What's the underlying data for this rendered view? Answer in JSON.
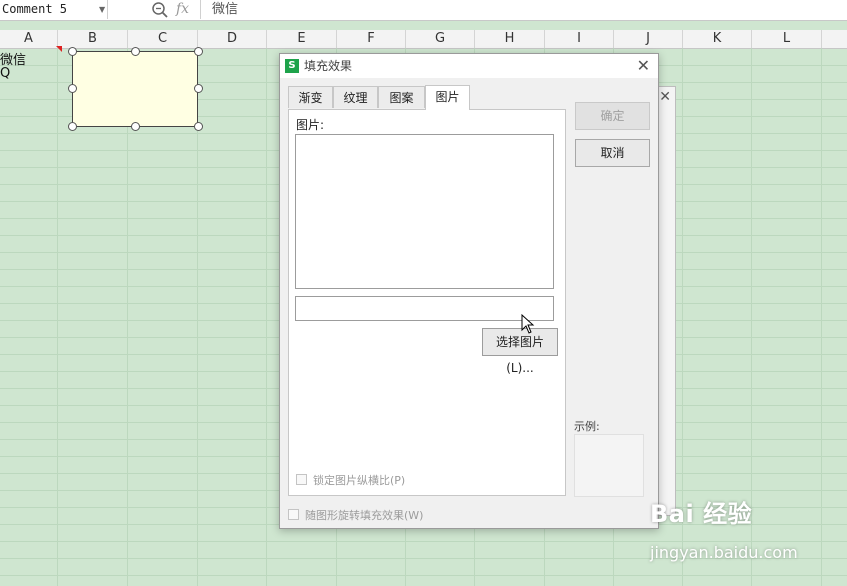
{
  "formula_bar": {
    "name_box": "Comment 5",
    "fx": "fx",
    "value": "微信"
  },
  "columns": [
    "A",
    "B",
    "C",
    "D",
    "E",
    "F",
    "G",
    "H",
    "I",
    "J",
    "K",
    "L"
  ],
  "cells": {
    "a1": "微信",
    "a2": "Q"
  },
  "dialog": {
    "app_icon": "S",
    "title": "填充效果",
    "close": "✕",
    "tabs": [
      "渐变",
      "纹理",
      "图案",
      "图片"
    ],
    "active_tab": "图片",
    "picture_label": "图片:",
    "path_value": "",
    "select_picture_button": "选择图片(L)...",
    "lock_ratio_label": "锁定图片纵横比(P)",
    "rotate_with_shape_label": "随图形旋转填充效果(W)",
    "ok_button": "确定",
    "cancel_button": "取消",
    "sample_label": "示例:"
  },
  "background_dialog": {
    "close": "✕"
  },
  "watermark": {
    "logo": "Bai 经验",
    "url": "jingyan.baidu.com"
  },
  "colors": {
    "sheet_background": "#cfe6d0",
    "comment_fill": "#ffffe3",
    "app_icon": "#1ea34b"
  }
}
